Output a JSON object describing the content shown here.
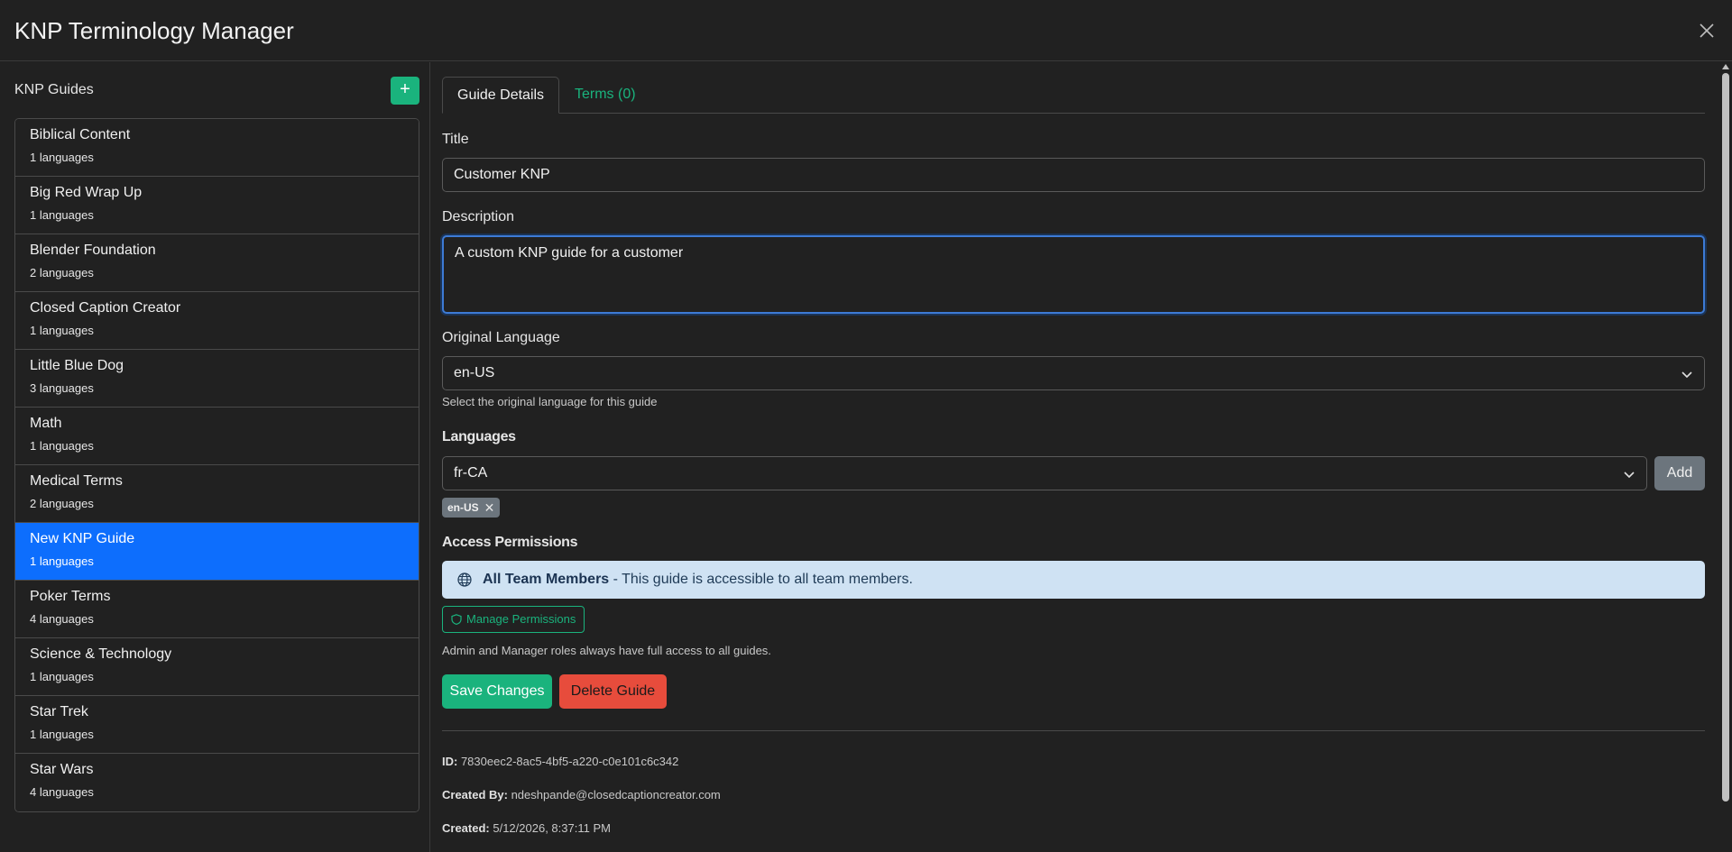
{
  "app": {
    "title": "KNP Terminology Manager"
  },
  "sidebar": {
    "heading": "KNP Guides",
    "add_label": "+",
    "guides": [
      {
        "name": "Biblical Content",
        "langs": "1 languages"
      },
      {
        "name": "Big Red Wrap Up",
        "langs": "1 languages"
      },
      {
        "name": "Blender Foundation",
        "langs": "2 languages"
      },
      {
        "name": "Closed Caption Creator",
        "langs": "1 languages"
      },
      {
        "name": "Little Blue Dog",
        "langs": "3 languages"
      },
      {
        "name": "Math",
        "langs": "1 languages"
      },
      {
        "name": "Medical Terms",
        "langs": "2 languages"
      },
      {
        "name": "New KNP Guide",
        "langs": "1 languages"
      },
      {
        "name": "Poker Terms",
        "langs": "4 languages"
      },
      {
        "name": "Science & Technology",
        "langs": "1 languages"
      },
      {
        "name": "Star Trek",
        "langs": "1 languages"
      },
      {
        "name": "Star Wars",
        "langs": "4 languages"
      }
    ],
    "selected_index": 7
  },
  "tabs": [
    {
      "label": "Guide Details",
      "active": true
    },
    {
      "label": "Terms (0)",
      "active": false
    }
  ],
  "form": {
    "title_label": "Title",
    "title_value": "Customer KNP",
    "description_label": "Description",
    "description_value": "A custom KNP guide for a customer",
    "original_language_label": "Original Language",
    "original_language_value": "en-US",
    "original_language_help": "Select the original language for this guide",
    "languages_label": "Languages",
    "languages_select_value": "fr-CA",
    "add_button": "Add",
    "language_chips": [
      "en-US"
    ],
    "access_label": "Access Permissions",
    "access_strong": "All Team Members",
    "access_text": " - This guide is accessible to all team members.",
    "manage_permissions": "Manage Permissions",
    "access_help": "Admin and Manager roles always have full access to all guides.",
    "save_button": "Save Changes",
    "delete_button": "Delete Guide"
  },
  "meta": {
    "id_label": "ID:",
    "id_value": " 7830eec2-8ac5-4bf5-a220-c0e101c6c342",
    "created_by_label": "Created By:",
    "created_by_value": " ndeshpande@closedcaptioncreator.com",
    "created_label": "Created:",
    "created_value": " 5/12/2026, 8:37:11 PM"
  },
  "colors": {
    "accent": "#1ab37d",
    "selected": "#0d6efd",
    "danger": "#e74c3c",
    "info_bg": "#cfe2f3"
  }
}
